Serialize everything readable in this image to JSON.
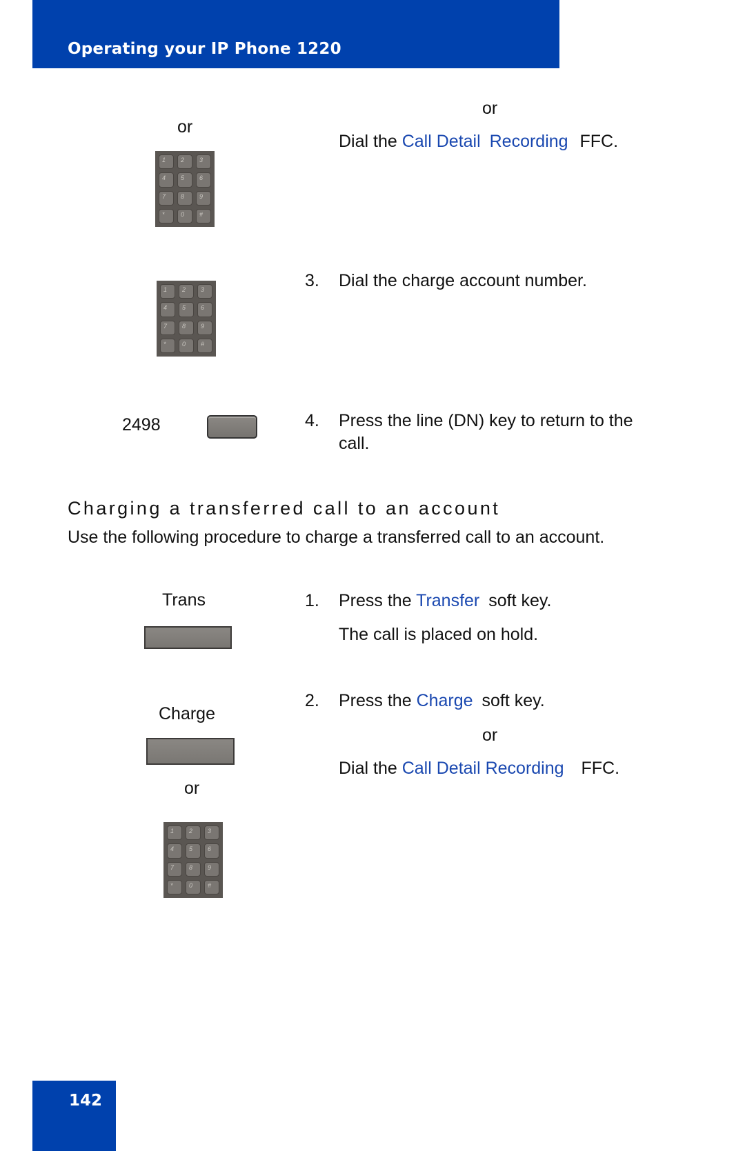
{
  "header": {
    "title": "Operating your IP Phone 1220"
  },
  "colors": {
    "brand_blue": "#0041ad",
    "link_blue": "#1a48b0"
  },
  "section_a": {
    "left_or": "or",
    "right_or": "or",
    "dial_prefix": "Dial the",
    "dial_link_1": "Call Detail",
    "dial_link_2": "Recording",
    "dial_suffix": "FFC.",
    "step3_num": "3.",
    "step3_text": "Dial the charge account number.",
    "line_key_label": "2498",
    "step4_num": "4.",
    "step4_line1": "Press the line (DN) key to return to the",
    "step4_line2": "call."
  },
  "section_b": {
    "heading": "Charging a transferred call to an account",
    "intro": "Use the following procedure to charge a transferred call to an account.",
    "trans_label": "Trans",
    "step1_num": "1.",
    "step1_prefix": "Press the",
    "step1_link": "Transfer",
    "step1_suffix": "soft key.",
    "step1_note": "The call is placed on hold.",
    "charge_label": "Charge",
    "left_or": "or",
    "step2_num": "2.",
    "step2_prefix": "Press the",
    "step2_link": "Charge",
    "step2_suffix": "soft key.",
    "right_or": "or",
    "dial_prefix": "Dial the",
    "dial_link": "Call Detail Recording",
    "dial_suffix": "FFC."
  },
  "keypad_keys": [
    "1",
    "2ABC",
    "3DEF",
    "4GHI",
    "5JKL",
    "6MNO",
    "7PQRS",
    "8TUV",
    "9WXYZ",
    "*",
    "0",
    "#"
  ],
  "footer": {
    "page_number": "142"
  }
}
